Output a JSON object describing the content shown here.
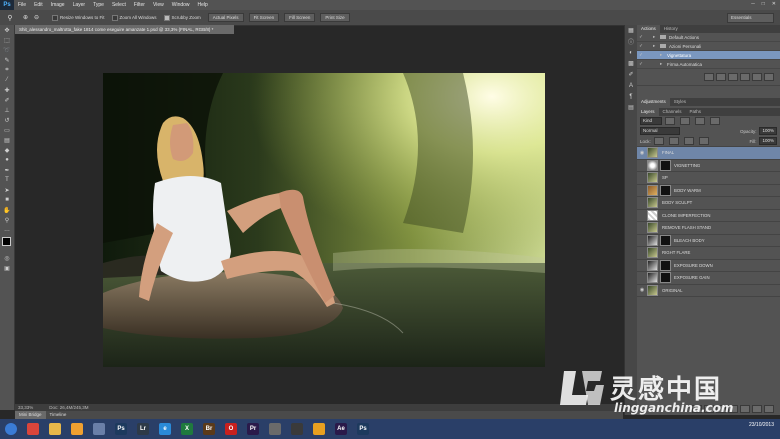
{
  "menubar": {
    "app_icon": "Ps",
    "items": [
      "File",
      "Edit",
      "Image",
      "Layer",
      "Type",
      "Select",
      "Filter",
      "View",
      "Window",
      "Help"
    ]
  },
  "options": {
    "checks": [
      {
        "label": "Resize Windows to Fit",
        "on": false
      },
      {
        "label": "Zoom All Windows",
        "on": false
      },
      {
        "label": "Scrubby Zoom",
        "on": true
      }
    ],
    "buttons": [
      "Actual Pixels",
      "Fit Screen",
      "Fill Screen",
      "Print Size"
    ],
    "workspace": "Essentials"
  },
  "document": {
    "tab_title": "Shit_alessandro_maltrotta_fake 1814 come eseguire amanzate 1.psd @ 33,3% (FINAL, RGB/8) *",
    "zoom": "33,33%",
    "doc_info": "Doc: 26,4M/245,3M",
    "bottom_tabs": [
      "Mini Bridge",
      "Timeline"
    ]
  },
  "actions_panel": {
    "tabs": [
      "Actions",
      "History"
    ],
    "rows": [
      {
        "label": "Default Actions",
        "level": 0,
        "folder": true,
        "hl": false
      },
      {
        "label": "Azioni Personali",
        "level": 0,
        "folder": true,
        "hl": false
      },
      {
        "label": "Vignettatura",
        "level": 1,
        "folder": false,
        "hl": true
      },
      {
        "label": "Firma Automatica",
        "level": 1,
        "folder": false,
        "hl": false
      }
    ]
  },
  "adjust_panel": {
    "tabs": [
      "Adjustments",
      "Styles"
    ]
  },
  "layers_panel": {
    "tabs": [
      "Layers",
      "Channels",
      "Paths"
    ],
    "kind_label": "Kind",
    "blend_mode": "Normal",
    "opacity_label": "Opacity:",
    "opacity": "100%",
    "lock_label": "Lock:",
    "fill_label": "Fill:",
    "fill": "100%",
    "layers": [
      {
        "name": "FINAL",
        "selected": true,
        "eye": true,
        "thumb": "photo",
        "mask": false
      },
      {
        "name": "VIGNETTING",
        "selected": false,
        "eye": false,
        "thumb": "vignette",
        "mask": true
      },
      {
        "name": "SP",
        "selected": false,
        "eye": false,
        "thumb": "photo",
        "mask": false
      },
      {
        "name": "BODY WARM",
        "selected": false,
        "eye": false,
        "thumb": "warm",
        "mask": true
      },
      {
        "name": "BODY SCULPT",
        "selected": false,
        "eye": false,
        "thumb": "photo",
        "mask": false
      },
      {
        "name": "CLONE IMPERFECTION",
        "selected": false,
        "eye": false,
        "thumb": "checker",
        "mask": false
      },
      {
        "name": "REMOVE FLASH STAND",
        "selected": false,
        "eye": false,
        "thumb": "photo",
        "mask": false
      },
      {
        "name": "BLEACH BODY",
        "selected": false,
        "eye": false,
        "thumb": "adj",
        "mask": true
      },
      {
        "name": "RIGHT FLARE",
        "selected": false,
        "eye": false,
        "thumb": "photo",
        "mask": false
      },
      {
        "name": "EXPOSURE DOWN",
        "selected": false,
        "eye": false,
        "thumb": "adj",
        "mask": true
      },
      {
        "name": "EXPOSURE GAIN",
        "selected": false,
        "eye": false,
        "thumb": "adj",
        "mask": true
      },
      {
        "name": "ORIGINAL",
        "selected": false,
        "eye": true,
        "thumb": "photo",
        "mask": false
      }
    ]
  },
  "taskbar": {
    "apps": [
      {
        "icon": "start-orb-icon",
        "color": "#3a7bd5",
        "text": ""
      },
      {
        "icon": "chrome-icon",
        "color": "#d9453b",
        "text": ""
      },
      {
        "icon": "explorer-folder-icon",
        "color": "#e8b84a",
        "text": ""
      },
      {
        "icon": "media-player-icon",
        "color": "#f0a030",
        "text": ""
      },
      {
        "icon": "apps-grid-icon",
        "color": "#6a7fa8",
        "text": ""
      },
      {
        "icon": "photoshop-icon",
        "color": "#1d3a5e",
        "text": "Ps"
      },
      {
        "icon": "lightroom-icon",
        "color": "#2e3a48",
        "text": "Lr"
      },
      {
        "icon": "internet-explorer-icon",
        "color": "#2a8ad8",
        "text": "e"
      },
      {
        "icon": "excel-icon",
        "color": "#1f7a3e",
        "text": "X"
      },
      {
        "icon": "bridge-icon",
        "color": "#5a3a1a",
        "text": "Br"
      },
      {
        "icon": "opera-icon",
        "color": "#c8201e",
        "text": "O"
      },
      {
        "icon": "premiere-icon",
        "color": "#2a1a4a",
        "text": "Pr"
      },
      {
        "icon": "film-icon",
        "color": "#6a6a6a",
        "text": ""
      },
      {
        "icon": "camera-app-icon",
        "color": "#3a3a3a",
        "text": ""
      },
      {
        "icon": "sun-icon",
        "color": "#e8a020",
        "text": ""
      },
      {
        "icon": "after-effects-icon",
        "color": "#2a1a4a",
        "text": "Ae"
      },
      {
        "icon": "photoshop-active-icon",
        "color": "#1d3a5e",
        "text": "Ps"
      }
    ],
    "clock_date": "23/10/2013"
  },
  "watermark": {
    "cn": "灵感中国",
    "url": "lingganchina.com"
  },
  "colors": {
    "panel": "#535353",
    "canvas": "#282828",
    "selection": "#7a97bf",
    "taskbar": "#2a3f68"
  }
}
